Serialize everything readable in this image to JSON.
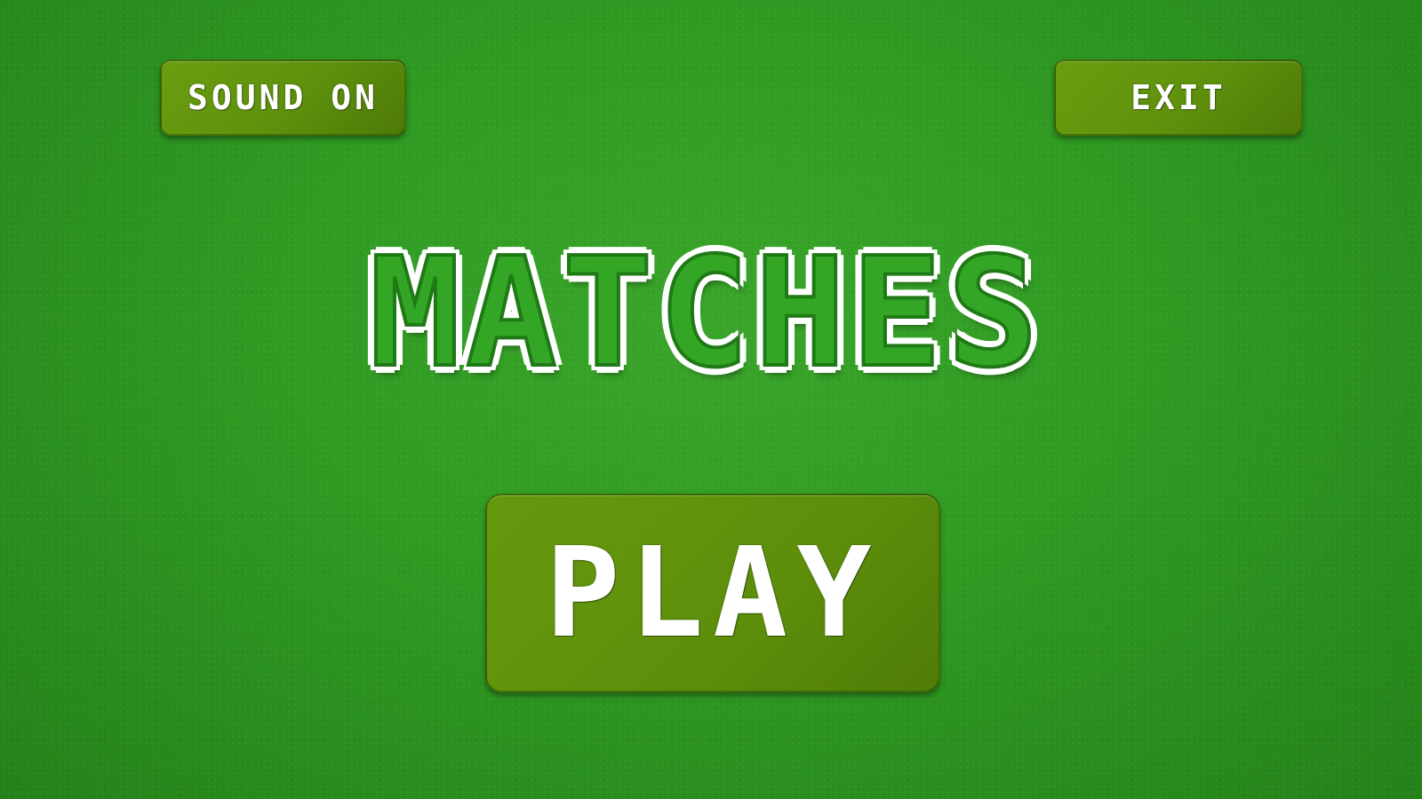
{
  "header": {
    "sound_label": "SOUND ON",
    "exit_label": "EXIT"
  },
  "title": "MATCHES",
  "main": {
    "play_label": "PLAY"
  },
  "colors": {
    "background": "#2f9a22",
    "button": "#5f900c",
    "title_fill": "#33a626",
    "title_outline": "#ffffff",
    "text": "#ffffff"
  }
}
